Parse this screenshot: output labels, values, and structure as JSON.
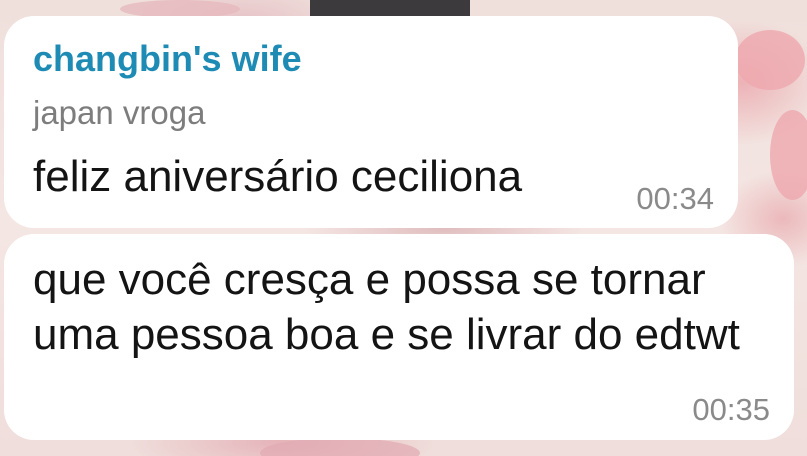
{
  "messages": [
    {
      "sender": "changbin's wife",
      "forwarded_from": "japan vroga",
      "text": "feliz aniversário ceciliona",
      "time": "00:34"
    },
    {
      "text": "que você cresça e possa se tornar uma pessoa boa e se livrar do edtwt",
      "time": "00:35"
    }
  ],
  "colors": {
    "sender_name": "#1e8bb5",
    "bubble": "#ffffff",
    "message_text": "#141414",
    "meta_text": "#8a8a8a"
  }
}
